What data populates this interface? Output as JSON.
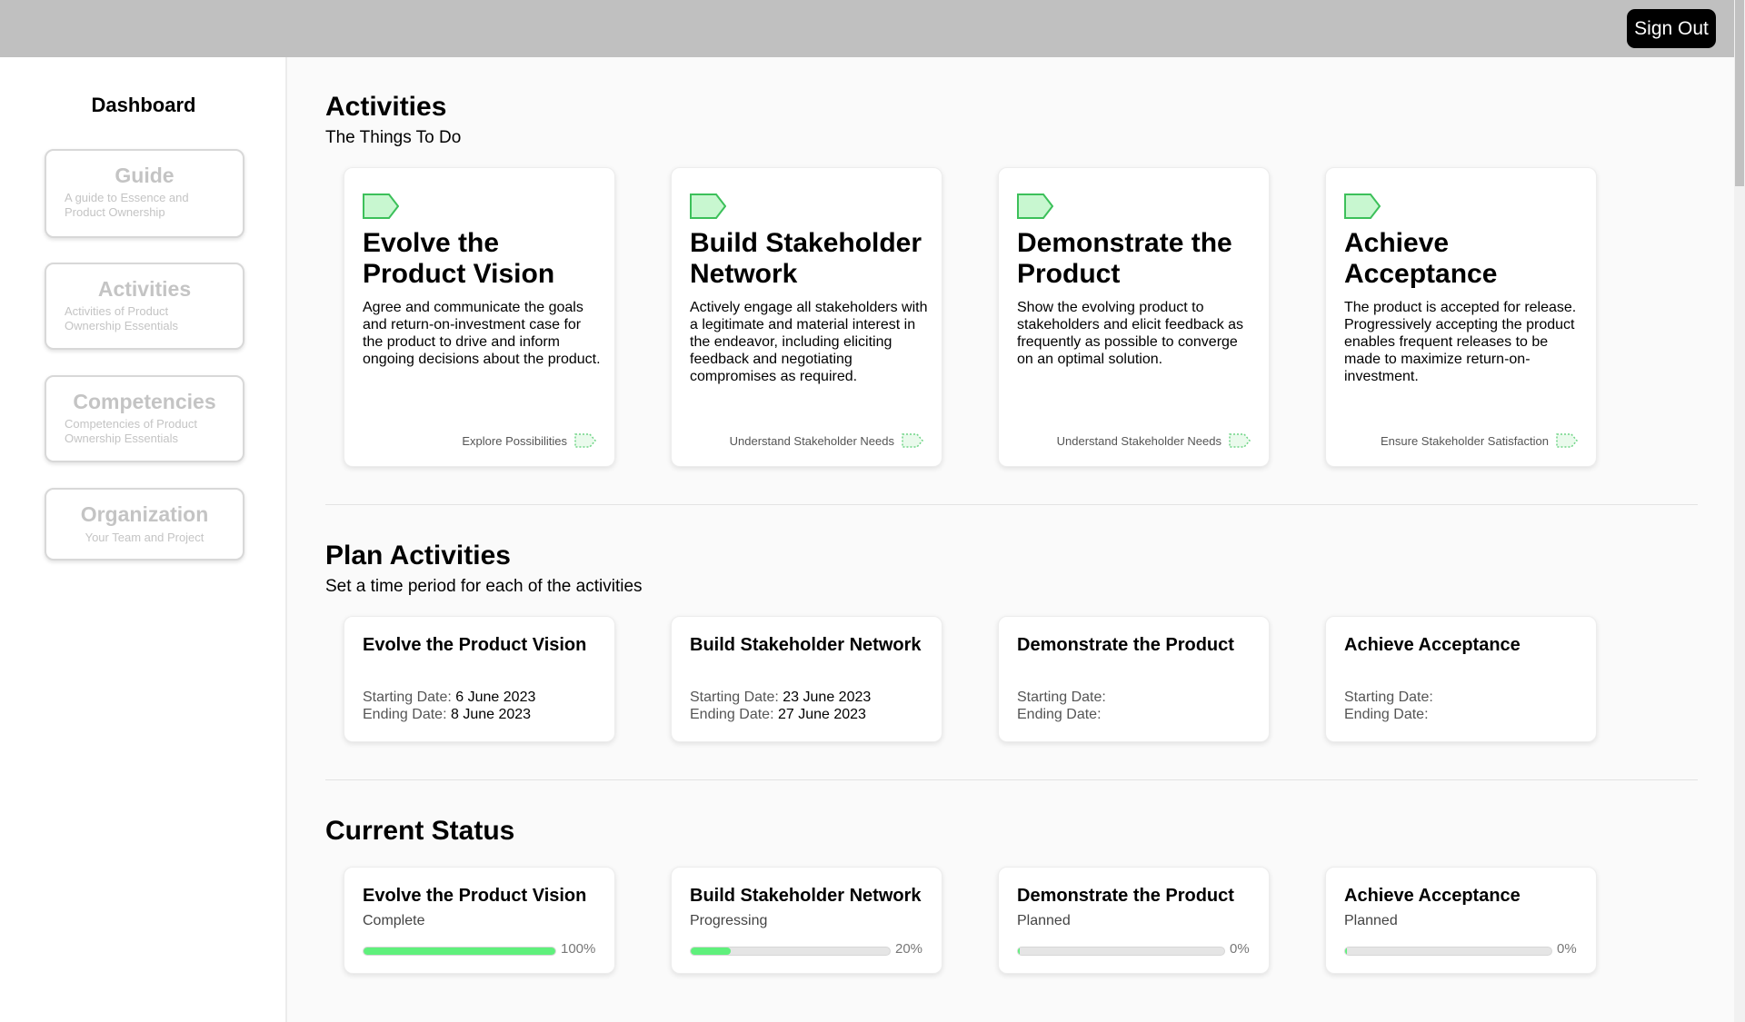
{
  "header": {
    "signout_label": "Sign Out"
  },
  "sidebar": {
    "title": "Dashboard",
    "items": [
      {
        "label": "Guide",
        "desc": "A guide to Essence and Product Ownership"
      },
      {
        "label": "Activities",
        "desc": "Activities of Product Ownership Essentials"
      },
      {
        "label": "Competencies",
        "desc": "Competencies of Product Ownership Essentials"
      },
      {
        "label": "Organization",
        "desc": "Your Team and Project"
      }
    ]
  },
  "activities": {
    "heading": "Activities",
    "subheading": "The Things To Do",
    "cards": [
      {
        "title": "Evolve the Product Vision",
        "desc": "Agree and communicate the goals and return-on-investment case for the product to drive and inform ongoing decisions about the product.",
        "footer": "Explore Possibilities"
      },
      {
        "title": "Build Stakeholder Network",
        "desc": "Actively engage all stakeholders with a legitimate and material interest in the endeavor, including eliciting feedback and negotiating compromises as required.",
        "footer": "Understand Stakeholder Needs"
      },
      {
        "title": "Demonstrate the Product",
        "desc": "Show the evolving product to stakeholders and elicit feedback as frequently as possible to converge on an optimal solution.",
        "footer": "Understand Stakeholder Needs"
      },
      {
        "title": "Achieve Acceptance",
        "desc": "The product is accepted for release. Progressively accepting the product enables frequent releases to be made to maximize return-on-investment.",
        "footer": "Ensure Stakeholder Satisfaction"
      }
    ]
  },
  "plan": {
    "heading": "Plan Activities",
    "subheading": "Set a time period for each of the activities",
    "start_label": "Starting Date:",
    "end_label": "Ending Date:",
    "cards": [
      {
        "title": "Evolve the Product Vision",
        "start": "6 June 2023",
        "end": "8 June 2023"
      },
      {
        "title": "Build Stakeholder Network",
        "start": "23 June 2023",
        "end": "27 June 2023"
      },
      {
        "title": "Demonstrate the Product",
        "start": "",
        "end": ""
      },
      {
        "title": "Achieve Acceptance",
        "start": "",
        "end": ""
      }
    ]
  },
  "status": {
    "heading": "Current Status",
    "cards": [
      {
        "title": "Evolve the Product Vision",
        "state": "Complete",
        "percent": 100,
        "percent_label": "100%"
      },
      {
        "title": "Build Stakeholder Network",
        "state": "Progressing",
        "percent": 20,
        "percent_label": "20%"
      },
      {
        "title": "Demonstrate the Product",
        "state": "Planned",
        "percent": 0,
        "percent_label": "0%"
      },
      {
        "title": "Achieve Acceptance",
        "state": "Planned",
        "percent": 0,
        "percent_label": "0%"
      }
    ]
  },
  "colors": {
    "accent_green": "#5ff07c",
    "tag_fill": "#c8f7d0",
    "tag_stroke": "#3cc05a"
  }
}
